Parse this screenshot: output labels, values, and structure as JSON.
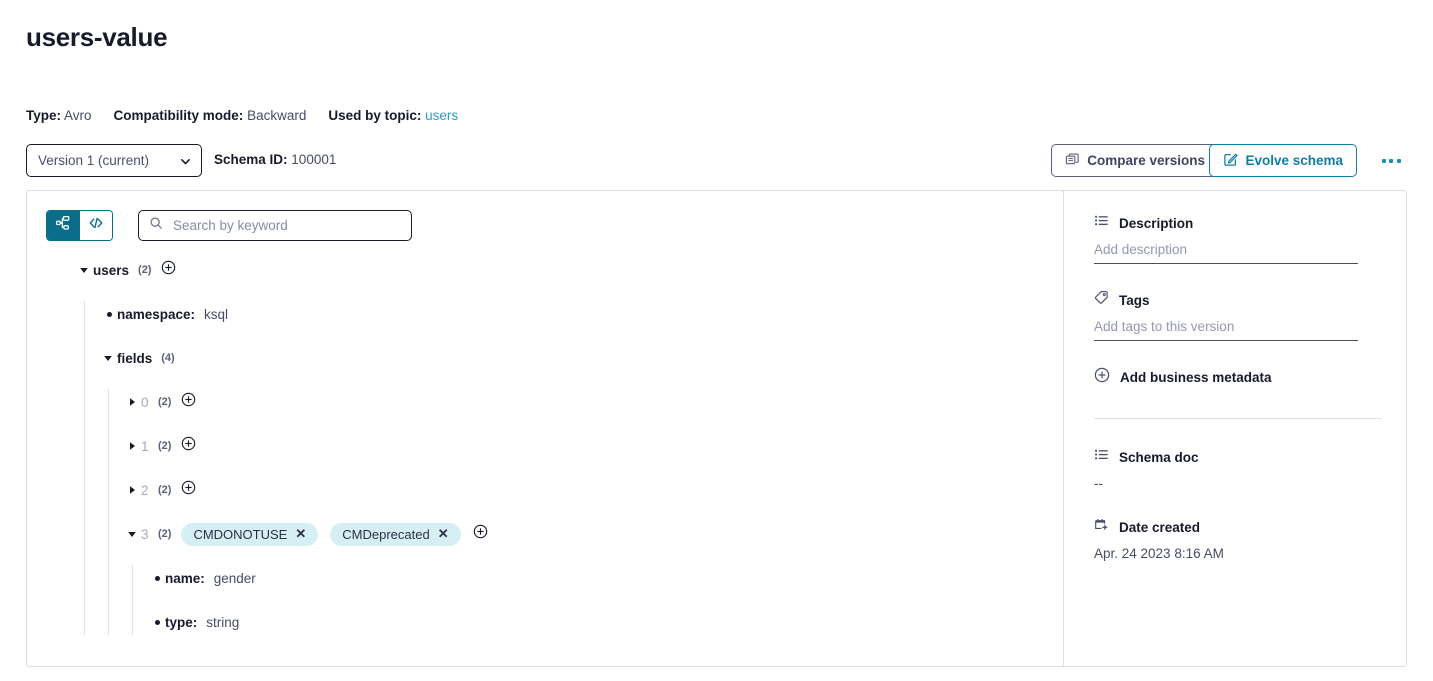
{
  "page_title": "users-value",
  "meta": {
    "type_label": "Type:",
    "type_value": "Avro",
    "compat_label": "Compatibility mode:",
    "compat_value": "Backward",
    "topic_label": "Used by topic:",
    "topic_value": "users"
  },
  "controls": {
    "version_selected": "Version 1 (current)",
    "schema_id_label": "Schema ID:",
    "schema_id_value": "100001",
    "compare_label": "Compare versions",
    "evolve_label": "Evolve schema",
    "kebab_name": "more-options"
  },
  "toolbar": {
    "tree_view_icon": "tree-icon",
    "code_view_icon": "code-icon",
    "search_placeholder": "Search by keyword",
    "search_value": ""
  },
  "tree": {
    "root": {
      "key": "users",
      "count": "(2)",
      "expanded": true
    },
    "namespace": {
      "key": "namespace:",
      "value": "ksql"
    },
    "fields": {
      "key": "fields",
      "count": "(4)",
      "expanded": true
    },
    "items": [
      {
        "index": "0",
        "count": "(2)",
        "expanded": false
      },
      {
        "index": "1",
        "count": "(2)",
        "expanded": false
      },
      {
        "index": "2",
        "count": "(2)",
        "expanded": false
      },
      {
        "index": "3",
        "count": "(2)",
        "expanded": true,
        "tags": [
          "CMDONOTUSE",
          "CMDeprecated"
        ],
        "children": [
          {
            "key": "name:",
            "value": "gender"
          },
          {
            "key": "type:",
            "value": "string"
          }
        ]
      }
    ]
  },
  "sidebar": {
    "description_title": "Description",
    "description_placeholder": "Add description",
    "tags_title": "Tags",
    "tags_placeholder": "Add tags to this version",
    "add_business_metadata": "Add business metadata",
    "schema_doc_title": "Schema doc",
    "schema_doc_value": "--",
    "date_created_title": "Date created",
    "date_created_value": "Apr. 24 2023 8:16 AM"
  },
  "colors": {
    "accent_teal": "#0d7ea8",
    "link_teal": "#2f9ec0",
    "seg_active": "#0a6e8a",
    "pill_bg": "#d6eff4",
    "text_dark": "#171a2b"
  }
}
